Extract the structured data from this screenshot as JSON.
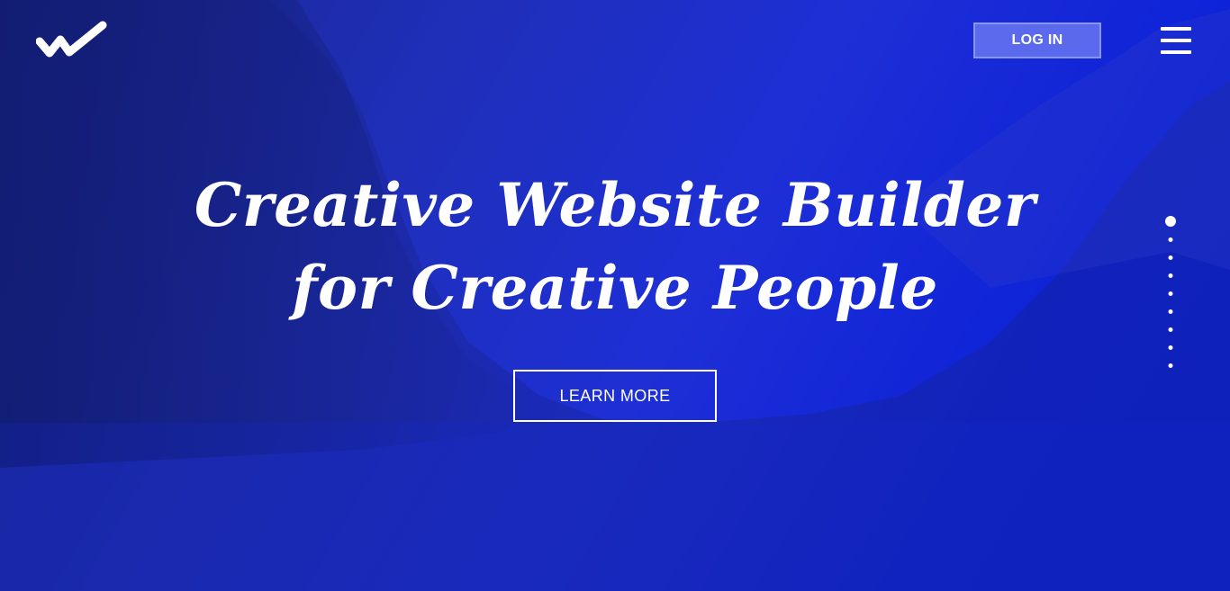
{
  "header": {
    "logo_icon": "checkmark-logo-icon",
    "login_label": "LOG IN",
    "menu_icon": "hamburger-menu-icon"
  },
  "hero": {
    "headline_line1": "Creative Website Builder",
    "headline_line2": "for Creative People",
    "cta_label": "LEARN MORE"
  },
  "slide_nav": {
    "total": 9,
    "active_index": 0
  },
  "colors": {
    "accent": "#1e2fd6",
    "text": "#ffffff"
  }
}
